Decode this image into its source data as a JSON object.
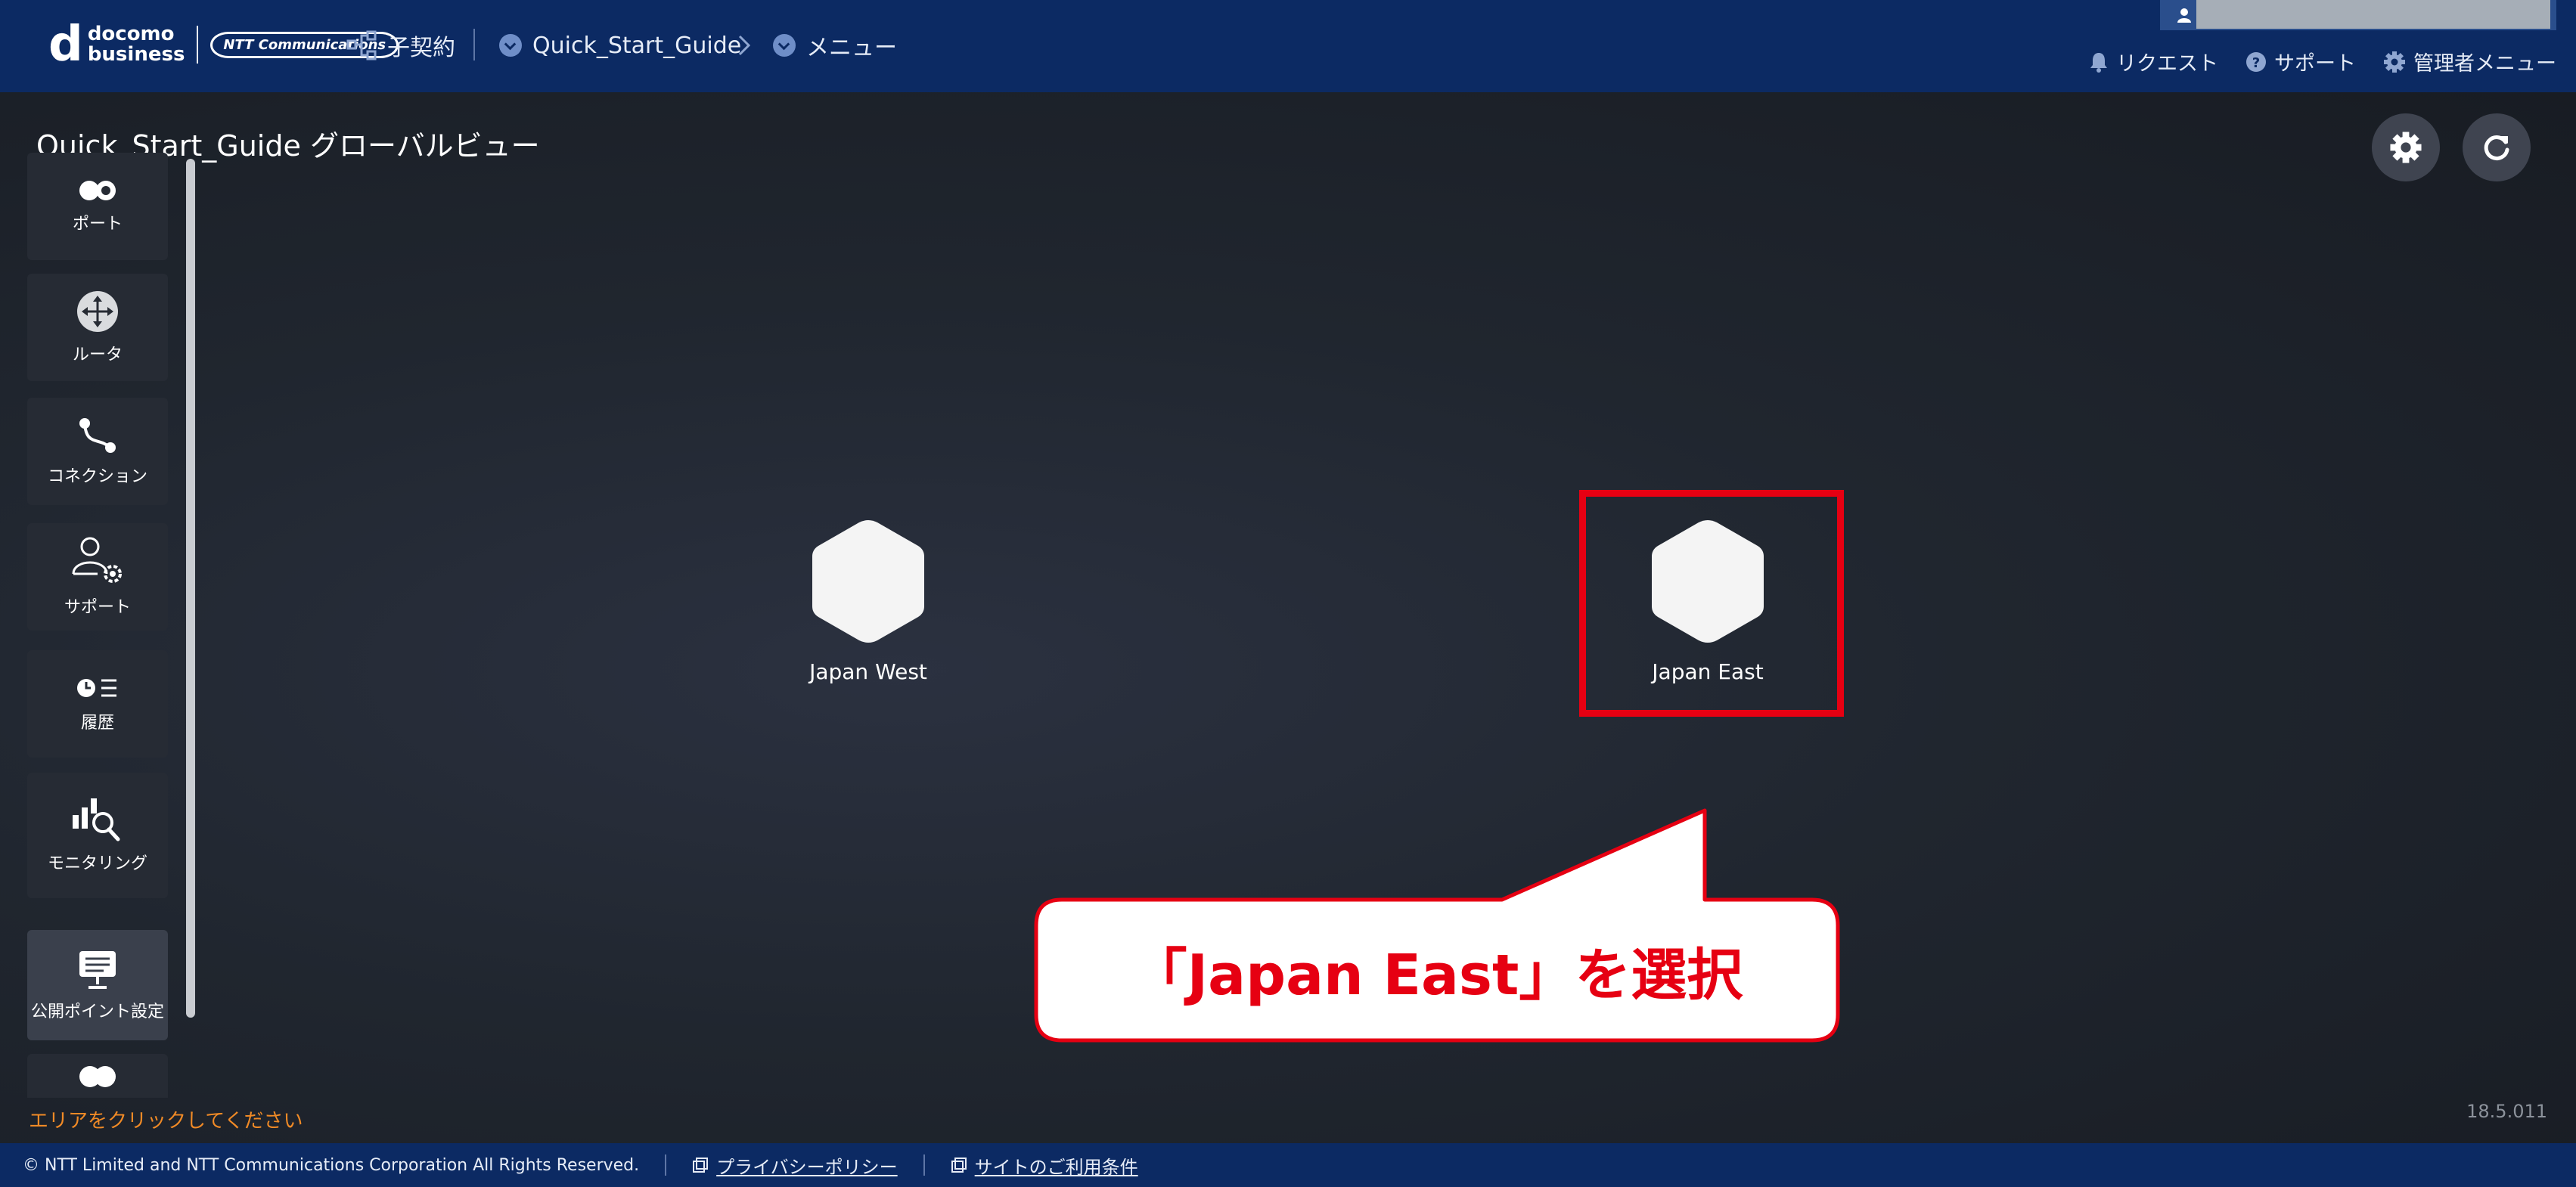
{
  "header": {
    "logo": {
      "mark": "d",
      "line1": "docomo",
      "line2": "business",
      "partner": "NTT Communications"
    },
    "nav": {
      "contract_label": "子契約",
      "guide_label": "Quick_Start_Guide",
      "menu_label": "メニュー"
    },
    "links": {
      "request": "リクエスト",
      "support": "サポート",
      "admin_menu": "管理者メニュー"
    }
  },
  "main": {
    "title": "Quick_Start_Guide グローバルビュー",
    "sidebar": [
      {
        "label": "ポート",
        "icon": "port-icon"
      },
      {
        "label": "ルータ",
        "icon": "router-icon"
      },
      {
        "label": "コネクション",
        "icon": "connection-icon"
      },
      {
        "label": "サポート",
        "icon": "support-user-icon"
      },
      {
        "label": "履歴",
        "icon": "history-icon"
      },
      {
        "label": "モニタリング",
        "icon": "monitoring-icon"
      },
      {
        "label": "公開ポイント設定",
        "icon": "public-point-icon"
      }
    ],
    "regions": [
      {
        "label": "Japan West"
      },
      {
        "label": "Japan East"
      }
    ],
    "callout_text": "「Japan East」を選択",
    "hint": "エリアをクリックしてください",
    "version": "18.5.011"
  },
  "footer": {
    "copyright": "© NTT Limited and NTT Communications Corporation All Rights Reserved.",
    "privacy": "プライバシーポリシー",
    "terms": "サイトのご利用条件"
  },
  "colors": {
    "header_bg": "#0c2a63",
    "highlight": "#e60012",
    "hint": "#f08a26"
  }
}
